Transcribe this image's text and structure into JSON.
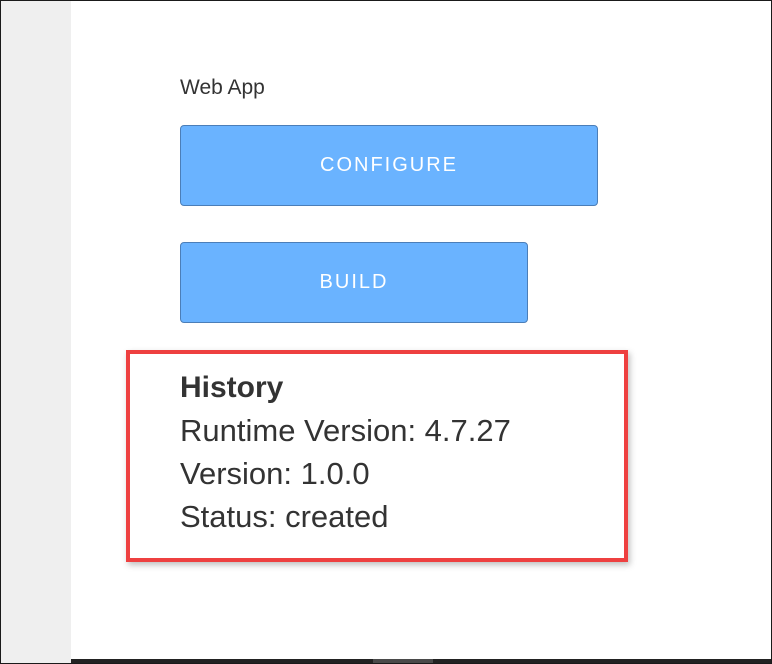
{
  "app": {
    "title": "Web App"
  },
  "actions": {
    "configure_label": "CONFIGURE",
    "build_label": "BUILD"
  },
  "history": {
    "title": "History",
    "runtime_version": "Runtime Version: 4.7.27",
    "version": "Version: 1.0.0",
    "status": "Status: created"
  },
  "colors": {
    "button_bg": "#6ab3ff",
    "button_border": "#4b7eb8",
    "highlight_border": "#ee4040",
    "text": "#333333",
    "rail": "#efefef"
  }
}
